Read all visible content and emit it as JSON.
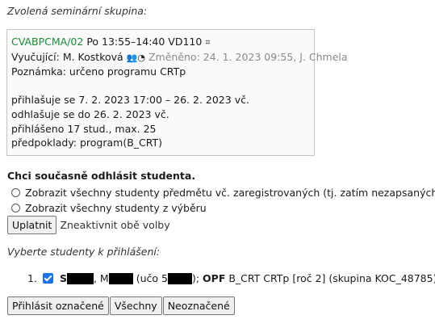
{
  "selected_group_heading": "Zvolená seminární skupina:",
  "group": {
    "code": "CVABPCMA/02",
    "schedule": "Po 13:55–14:40 VD110",
    "teacher_label": "Vyučující:",
    "teacher": "M. Kostková",
    "changed": "Změněno: 24. 1. 2023 09:55, J. Chmela",
    "note": "Poznámka: určeno programu CRTp",
    "enroll_period": "přihlašuje se 7. 2. 2023 17:00 – 26. 2. 2023 vč.",
    "unenroll_until": "odhlašuje se do 26. 2. 2023 vč.",
    "enrolled_count": "přihlášeno 17 stud., max. 25",
    "prerequisites": "předpoklady: program(B_CRT)"
  },
  "unenroll_title": "Chci současně odhlásit studenta.",
  "options": {
    "all_students": "Zobrazit všechny studenty předmětu vč. zaregistrovaných (tj. zatím nezapsaných)",
    "from_selection": "Zobrazit všechny studenty z výběru"
  },
  "apply_button": "Uplatnit",
  "deactivate_link": "Zneaktivnit obě volby",
  "select_heading": "Vyberte studenty k přihlášení:",
  "student": {
    "number": "1.",
    "first_initial": "S",
    "name_comma": ",",
    "second_initial": "M",
    "uco_prefix": "(učo 5",
    "uco_suffix": ");",
    "faculty": "OPF",
    "program": "B_CRT CRTp [roč 2] (skupina KOC_48785)"
  },
  "buttons": {
    "enroll_selected": "Přihlásit označené",
    "all": "Všechny",
    "unselected": "Neoznačené"
  }
}
